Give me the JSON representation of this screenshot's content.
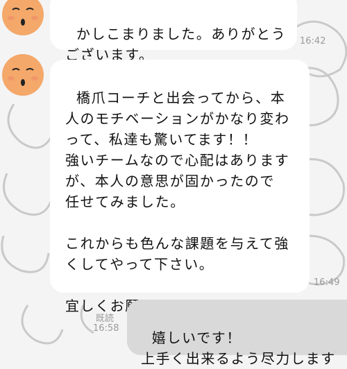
{
  "messages": [
    {
      "from": "other",
      "text": "かしこまりました。ありがとう\nございます。",
      "time": "16:42"
    },
    {
      "from": "other",
      "text": "橋爪コーチと出会ってから、本\n人のモチベーションがかなり変わ\nって、私達も驚いてます！！\n強いチームなので心配はあります\nが、本人の意思が固かったので\n任せてみました。\n\nこれからも色んな課題を与えて強\nくしてやって下さい。\n\n宜しくお願いします。",
      "time": "16:49"
    },
    {
      "from": "me",
      "text": "嬉しいです！\n上手く出来るよう尽力します",
      "read": "既読",
      "time": "16:58"
    }
  ],
  "colors": {
    "avatar": "#f4a86a",
    "incoming_bubble": "#ffffff",
    "outgoing_bubble": "#d9d9d9",
    "background": "#f4f4f4"
  }
}
